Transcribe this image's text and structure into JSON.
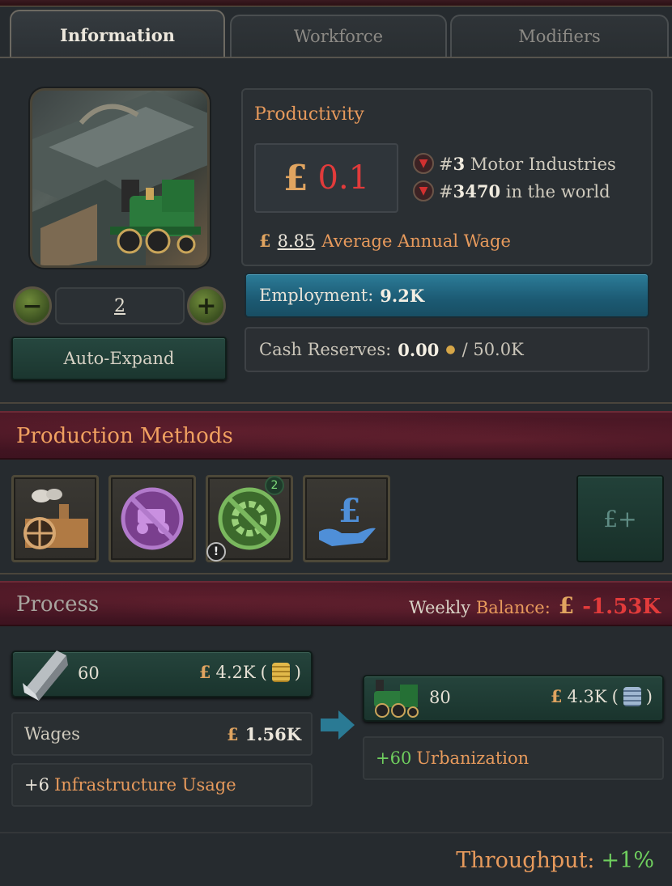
{
  "tabs": [
    {
      "label": "Information",
      "active": true
    },
    {
      "label": "Workforce",
      "active": false
    },
    {
      "label": "Modifiers",
      "active": false
    }
  ],
  "building": {
    "image_icon": "locomotive-factory-icon",
    "level": "2",
    "auto_expand_label": "Auto-Expand"
  },
  "productivity": {
    "title": "Productivity",
    "currency": "£",
    "value": "0.1",
    "ranks": [
      {
        "prefix": "#",
        "rank": "3",
        "label": "Motor Industries"
      },
      {
        "prefix": "#",
        "rank": "3470",
        "label": "in the world"
      }
    ],
    "wage_value": "8.85",
    "wage_label": "Average Annual Wage"
  },
  "employment": {
    "label": "Employment:",
    "value": "9.2K",
    "fill": 1.0
  },
  "cash": {
    "label": "Cash Reserves:",
    "value": "0.00",
    "max": "/ 50.0K"
  },
  "production_methods": {
    "title": "Production Methods",
    "tiles": [
      {
        "icon": "factory-icon"
      },
      {
        "icon": "no-automobile-icon"
      },
      {
        "icon": "no-automation-icon",
        "badge": "2",
        "warning": "!"
      },
      {
        "icon": "hand-money-icon"
      }
    ],
    "add_button_label": "£+"
  },
  "process": {
    "title": "Process",
    "weekly_label": "Weekly",
    "balance_label": "Balance:",
    "balance_value": "-1.53K",
    "input": {
      "icon": "steel-icon",
      "qty": "60",
      "value": "4.2K",
      "paren_open": "(",
      "paren_close": ")"
    },
    "wages": {
      "label": "Wages",
      "value": "1.56K"
    },
    "infrastructure": {
      "plus": "+6",
      "label": "Infrastructure Usage"
    },
    "output": {
      "icon": "engines-icon",
      "qty": "80",
      "value": "4.3K",
      "paren_open": "(",
      "paren_close": ")"
    },
    "urbanization": {
      "plus": "+60",
      "label": "Urbanization"
    },
    "throughput_label": "Throughput:",
    "throughput_value": "+1%"
  },
  "colors": {
    "accent_orange": "#e79a5c",
    "negative_red": "#e23b3b",
    "positive_green": "#6fcf5e",
    "employment_blue": "#2c7c98"
  }
}
